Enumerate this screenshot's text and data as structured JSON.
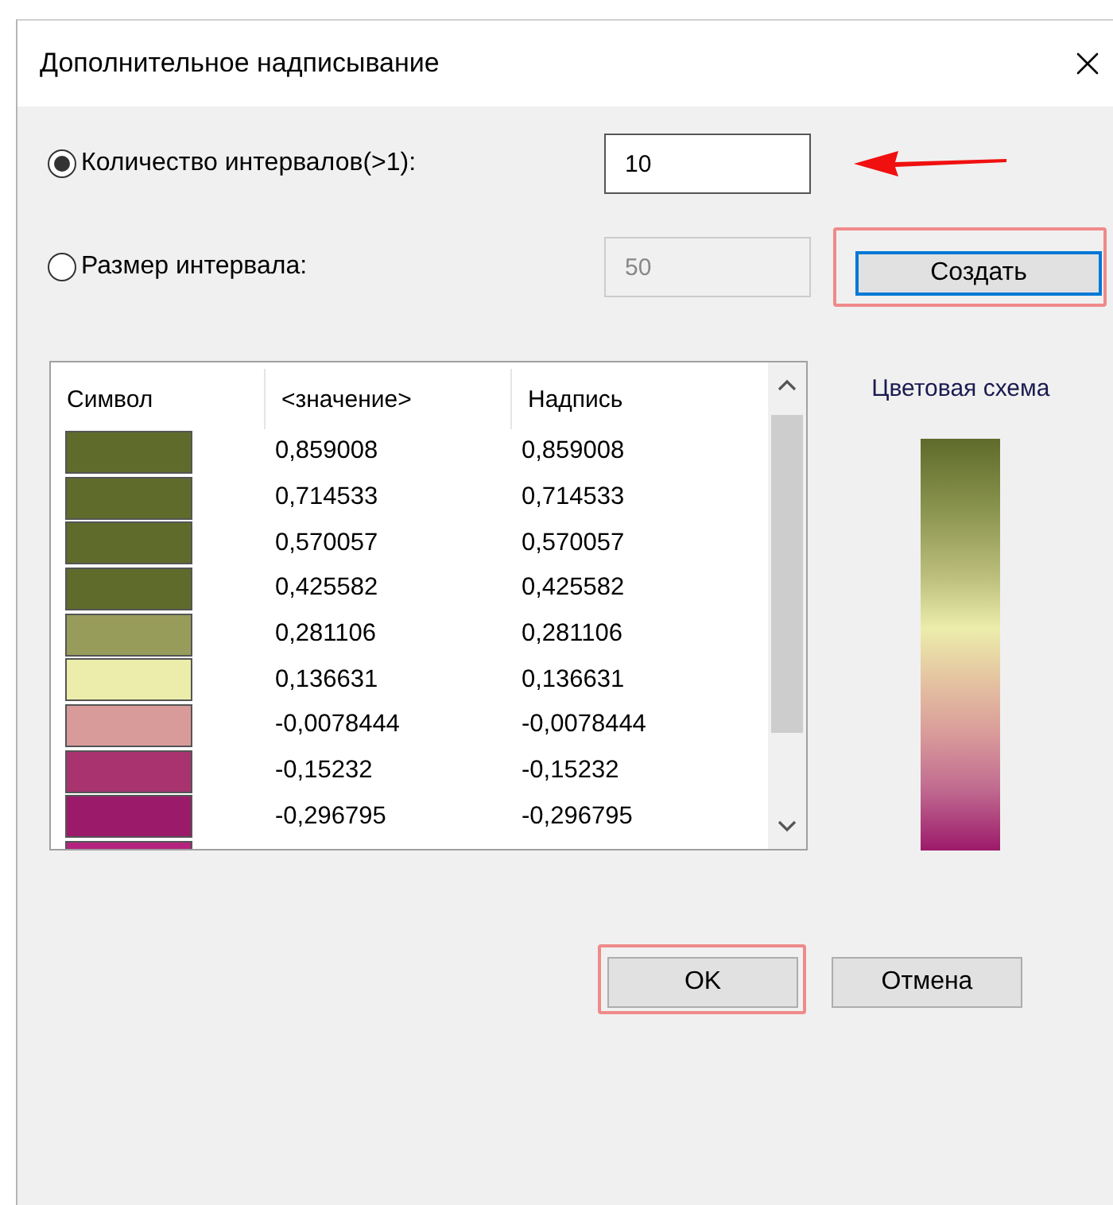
{
  "window": {
    "title": "Дополнительное надписывание"
  },
  "modes": [
    {
      "label": "Количество интервалов(>1):",
      "selected": true,
      "value": "10",
      "disabled": false,
      "pointed": true
    },
    {
      "label": "Размер интервала:",
      "selected": false,
      "value": "50",
      "disabled": true,
      "pointed": false
    }
  ],
  "create_button": {
    "label": "Создать",
    "highlighted": true,
    "focused": true
  },
  "table": {
    "columns": [
      "Символ",
      "<значение>",
      "Надпись"
    ],
    "rows": [
      {
        "color": "#5f6b2b",
        "value": "0,859008",
        "label": "0,859008"
      },
      {
        "color": "#5f6b2b",
        "value": "0,714533",
        "label": "0,714533"
      },
      {
        "color": "#5f6b2b",
        "value": "0,570057",
        "label": "0,570057"
      },
      {
        "color": "#5f6b2b",
        "value": "0,425582",
        "label": "0,425582"
      },
      {
        "color": "#989c5a",
        "value": "0,281106",
        "label": "0,281106"
      },
      {
        "color": "#ecedaa",
        "value": "0,136631",
        "label": "0,136631"
      },
      {
        "color": "#d99a9a",
        "value": "-0,0078444",
        "label": "-0,0078444"
      },
      {
        "color": "#a8336f",
        "value": "-0,15232",
        "label": "-0,15232"
      },
      {
        "color": "#9c1a6a",
        "value": "-0,296795",
        "label": "-0,296795"
      },
      {
        "color": "#b5237f"
      }
    ]
  },
  "color_scheme": {
    "title": "Цветовая схема"
  },
  "buttons": [
    {
      "label": "OK",
      "highlighted": true
    },
    {
      "label": "Отмена",
      "highlighted": false
    }
  ]
}
